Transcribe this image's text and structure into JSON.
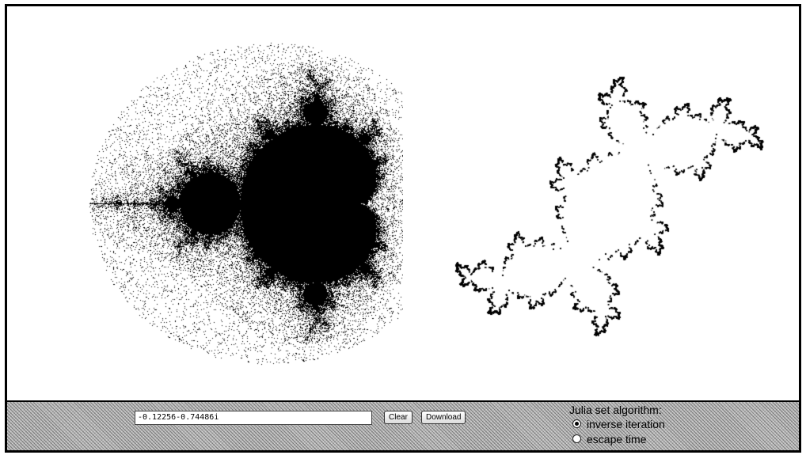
{
  "c_value": "-0.12256-0.74486i",
  "buttons": {
    "clear_label": "Clear",
    "download_label": "Download"
  },
  "algorithm": {
    "title": "Julia set algorithm:",
    "options": [
      {
        "label": "inverse iteration",
        "selected": true
      },
      {
        "label": "escape time",
        "selected": false
      }
    ]
  },
  "colors": {
    "fractal": "#000000",
    "background": "#ffffff",
    "control_bar": "#b9b9b9"
  }
}
